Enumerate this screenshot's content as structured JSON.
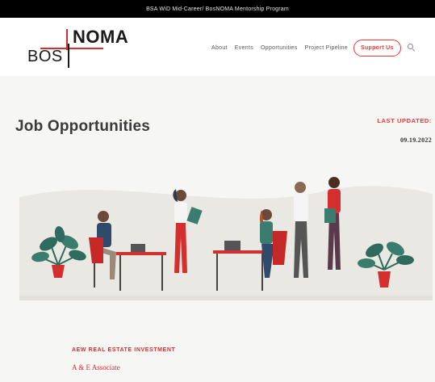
{
  "banner": {
    "text": "BSA WiD Mid-Career/ BosNOMA Mentorship Program"
  },
  "logo": {
    "left_text": "BOS",
    "right_text": "NOMA"
  },
  "nav": {
    "items": [
      "About",
      "Events",
      "Opportunities",
      "Project Pipeline"
    ],
    "support_label": "Support Us",
    "search_icon": "search-icon"
  },
  "page": {
    "title": "Job Opportunities",
    "last_updated_label": "LAST UPDATED:",
    "last_updated_date": "09.19.2022"
  },
  "listings": [
    {
      "company": "AEW REAL ESTATE INVESTMENT",
      "title": "A & E Associate"
    }
  ],
  "colors": {
    "accent": "#e53935",
    "brand_red": "#d32f2f",
    "banner": "#000000"
  }
}
